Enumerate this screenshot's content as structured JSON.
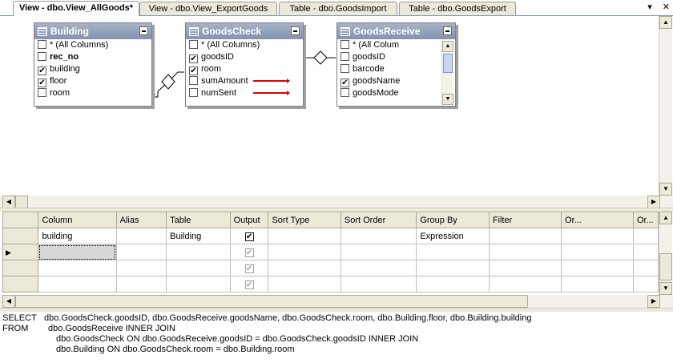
{
  "tabs": [
    {
      "label": "View - dbo.View_AllGoods*",
      "active": true
    },
    {
      "label": "View - dbo.View_ExportGoods",
      "active": false
    },
    {
      "label": "Table - dbo.GoodsImport",
      "active": false
    },
    {
      "label": "Table - dbo.GoodsExport",
      "active": false
    }
  ],
  "tab_controls": {
    "dropdown": "▾",
    "close": "✕"
  },
  "tables": {
    "building": {
      "title": "Building",
      "columns": [
        {
          "label": "* (All Columns)",
          "checked": false,
          "bold": false
        },
        {
          "label": "rec_no",
          "checked": false,
          "bold": true
        },
        {
          "label": "building",
          "checked": true,
          "bold": false
        },
        {
          "label": "floor",
          "checked": true,
          "bold": false
        },
        {
          "label": "room",
          "checked": false,
          "bold": false
        }
      ]
    },
    "goodscheck": {
      "title": "GoodsCheck",
      "columns": [
        {
          "label": "* (All Columns)",
          "checked": false
        },
        {
          "label": "goodsID",
          "checked": true
        },
        {
          "label": "room",
          "checked": true
        },
        {
          "label": "sumAmount",
          "checked": false
        },
        {
          "label": "numSent",
          "checked": false
        }
      ]
    },
    "goodsreceive": {
      "title": "GoodsReceive",
      "columns": [
        {
          "label": "* (All Colum",
          "checked": false
        },
        {
          "label": "goodsID",
          "checked": false
        },
        {
          "label": "barcode",
          "checked": false
        },
        {
          "label": "goodsName",
          "checked": true
        },
        {
          "label": "goodsMode",
          "checked": false
        }
      ]
    }
  },
  "grid": {
    "headers": [
      "Column",
      "Alias",
      "Table",
      "Output",
      "Sort Type",
      "Sort Order",
      "Group By",
      "Filter",
      "Or...",
      "Or..."
    ],
    "rows": [
      {
        "column": "building",
        "alias": "",
        "table": "Building",
        "output": true,
        "sort_type": "",
        "sort_order": "",
        "group_by": "Expression",
        "filter": ""
      },
      {
        "column": "",
        "alias": "",
        "table": "",
        "output": true,
        "sort_type": "",
        "sort_order": "",
        "group_by": "",
        "filter": ""
      },
      {
        "column": "",
        "alias": "",
        "table": "",
        "output": true,
        "sort_type": "",
        "sort_order": "",
        "group_by": "",
        "filter": ""
      },
      {
        "column": "",
        "alias": "",
        "table": "",
        "output": true,
        "sort_type": "",
        "sort_order": "",
        "group_by": "",
        "filter": ""
      }
    ]
  },
  "sql": {
    "line1_kw": "SELECT",
    "line1": "dbo.GoodsCheck.goodsID, dbo.GoodsReceive.goodsName, dbo.GoodsCheck.room, dbo.Building.floor, dbo.Building.building",
    "line2_kw": "FROM",
    "line2": "dbo.GoodsReceive INNER JOIN",
    "line3": "dbo.GoodsCheck ON dbo.GoodsReceive.goodsID = dbo.GoodsCheck.goodsID INNER JOIN",
    "line4": "dbo.Building ON dbo.GoodsCheck.room = dbo.Building.room"
  },
  "scroll_glyphs": {
    "up": "▲",
    "down": "▼",
    "left": "◀",
    "right": "▶"
  },
  "check_glyph": "✔",
  "row_pointer": "▶",
  "colors": {
    "title_bar": "#8f9db7",
    "annotation_red": "#e00000",
    "chrome": "#ece9d8"
  }
}
